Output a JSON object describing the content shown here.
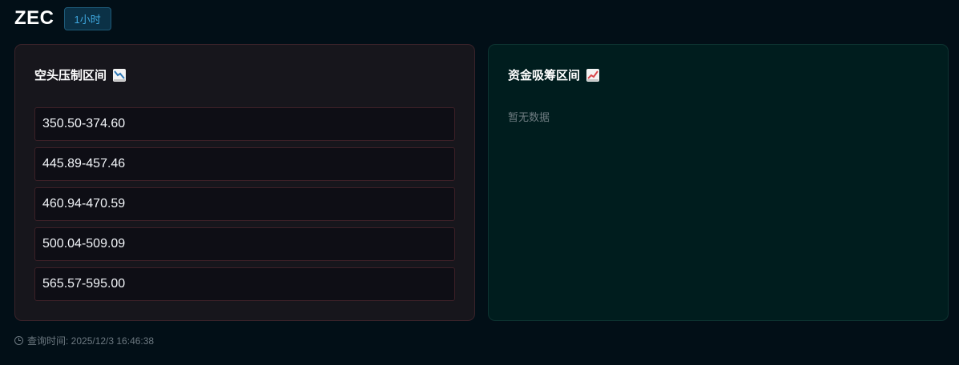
{
  "header": {
    "symbol": "ZEC",
    "timeframe": "1小时"
  },
  "short_zone_panel": {
    "title": "空头压制区间",
    "icon": "chart-decreasing-icon",
    "zones": [
      "350.50-374.60",
      "445.89-457.46",
      "460.94-470.59",
      "500.04-509.09",
      "565.57-595.00"
    ]
  },
  "accumulation_panel": {
    "title": "资金吸筹区间",
    "icon": "chart-increasing-icon",
    "empty_text": "暂无数据"
  },
  "footer": {
    "query_time": "查询时间: 2025/12/3 16:46:38"
  },
  "colors": {
    "background": "#020f17",
    "timeframe_accent": "#3fa9e0",
    "short_border": "#3a232a",
    "accum_background": "#001d1e"
  }
}
